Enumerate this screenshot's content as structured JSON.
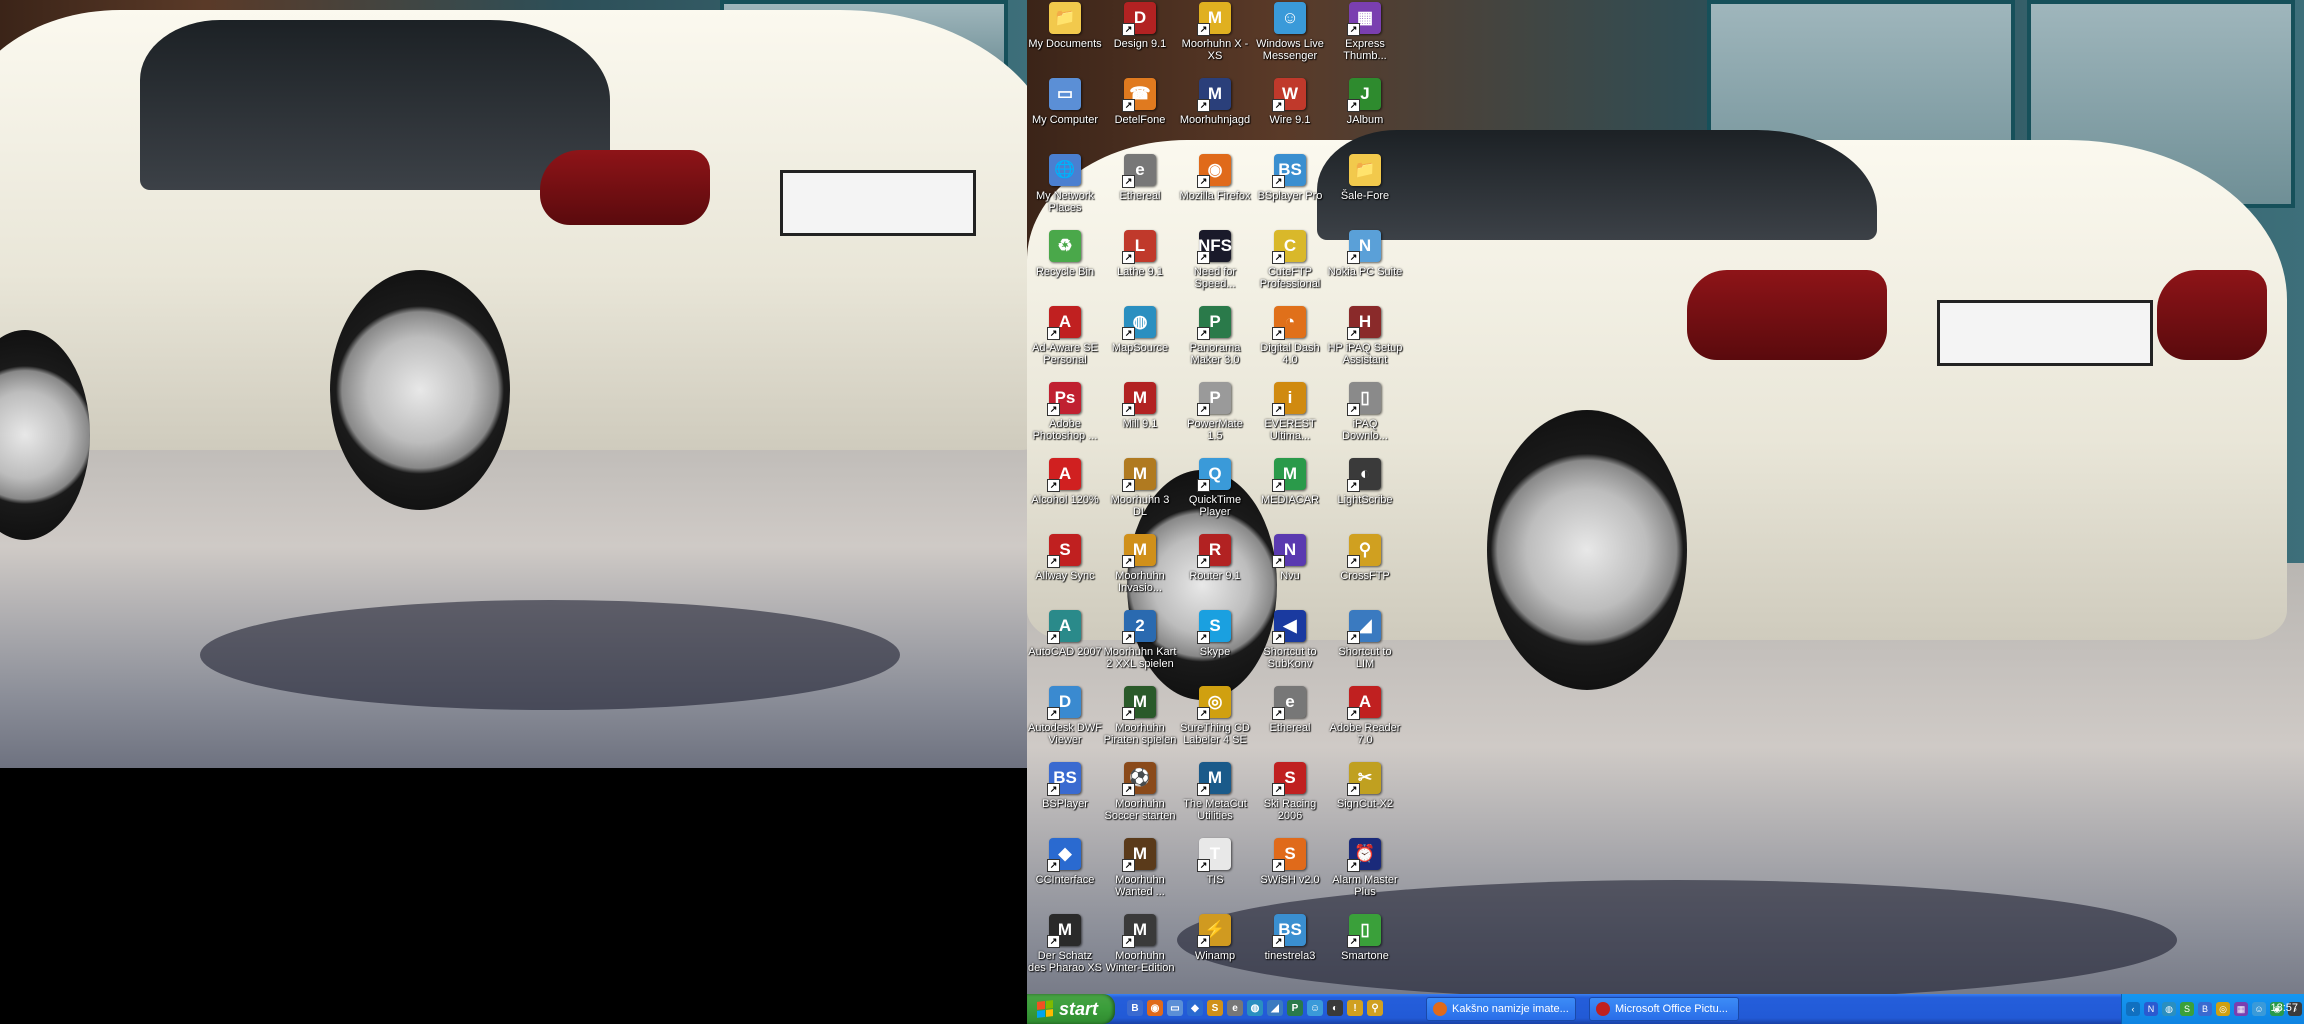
{
  "desktop": {
    "icons": [
      {
        "id": "my-documents",
        "label": "My Documents",
        "color": "#f2c94c",
        "glyph": "📁",
        "shortcut": false
      },
      {
        "id": "design-9-1",
        "label": "Design 9.1",
        "color": "#b22222",
        "glyph": "D",
        "shortcut": true
      },
      {
        "id": "moorhuhn-x-xs",
        "label": "Moorhuhn X -\nXS",
        "color": "#e0b020",
        "glyph": "M",
        "shortcut": true
      },
      {
        "id": "windows-live-messenger",
        "label": "Windows Live\nMessenger",
        "color": "#3a9ad9",
        "glyph": "☺",
        "shortcut": false
      },
      {
        "id": "express-thumb",
        "label": "Express\nThumb...",
        "color": "#7a3fb0",
        "glyph": "▦",
        "shortcut": true
      },
      {
        "id": "my-computer",
        "label": "My Computer",
        "color": "#5b8fd6",
        "glyph": "▭",
        "shortcut": false
      },
      {
        "id": "detelfone",
        "label": "DetelFone",
        "color": "#e07a1f",
        "glyph": "☎",
        "shortcut": true
      },
      {
        "id": "moorhuhnjagd",
        "label": "Moorhuhnjagd",
        "color": "#2a3f7a",
        "glyph": "M",
        "shortcut": true
      },
      {
        "id": "wire-9-1",
        "label": "Wire 9.1",
        "color": "#c0392b",
        "glyph": "W",
        "shortcut": true
      },
      {
        "id": "jalbum",
        "label": "JAlbum",
        "color": "#2e8b2e",
        "glyph": "J",
        "shortcut": true
      },
      {
        "id": "my-network-places",
        "label": "My Network\nPlaces",
        "color": "#4a7fd0",
        "glyph": "🌐",
        "shortcut": false
      },
      {
        "id": "ethereal-1",
        "label": "Ethereal",
        "color": "#777777",
        "glyph": "e",
        "shortcut": true
      },
      {
        "id": "mozilla-firefox",
        "label": "Mozilla Firefox",
        "color": "#e06a1a",
        "glyph": "◉",
        "shortcut": true
      },
      {
        "id": "bsplayer-pro",
        "label": "BSplayer Pro",
        "color": "#3a8fd0",
        "glyph": "BS",
        "shortcut": true
      },
      {
        "id": "sale-fore",
        "label": "Šale-Fore",
        "color": "#f2c94c",
        "glyph": "📁",
        "shortcut": false
      },
      {
        "id": "recycle-bin",
        "label": "Recycle Bin",
        "color": "#4aa84a",
        "glyph": "♻",
        "shortcut": false
      },
      {
        "id": "lathe-9-1",
        "label": "Lathe 9.1",
        "color": "#c0392b",
        "glyph": "L",
        "shortcut": true
      },
      {
        "id": "need-for-speed",
        "label": "Need for\nSpeed...",
        "color": "#1a1a2a",
        "glyph": "NFS",
        "shortcut": true
      },
      {
        "id": "cuteftp-professional",
        "label": "CuteFTP\nProfessional",
        "color": "#d9b82a",
        "glyph": "C",
        "shortcut": true
      },
      {
        "id": "nokia-pc-suite",
        "label": "Nokia PC Suite",
        "color": "#5aa0d8",
        "glyph": "N",
        "shortcut": true
      },
      {
        "id": "ad-aware-se",
        "label": "Ad-Aware SE\nPersonal",
        "color": "#c02020",
        "glyph": "A",
        "shortcut": true
      },
      {
        "id": "mapsource",
        "label": "MapSource",
        "color": "#2a8fc0",
        "glyph": "◍",
        "shortcut": true
      },
      {
        "id": "panorama-maker",
        "label": "Panorama\nMaker 3.0",
        "color": "#2a7a4a",
        "glyph": "P",
        "shortcut": true
      },
      {
        "id": "digital-dash",
        "label": "Digital Dash\n4.0",
        "color": "#e0701a",
        "glyph": "◔",
        "shortcut": true
      },
      {
        "id": "hp-ipaq-setup",
        "label": "HP iPAQ Setup\nAssistant",
        "color": "#8a2a2a",
        "glyph": "H",
        "shortcut": true
      },
      {
        "id": "adobe-photoshop",
        "label": "Adobe\nPhotoshop ...",
        "color": "#c02030",
        "glyph": "Ps",
        "shortcut": true
      },
      {
        "id": "mill-9-1",
        "label": "Mill 9.1",
        "color": "#b22222",
        "glyph": "M",
        "shortcut": true
      },
      {
        "id": "powermate",
        "label": "PowerMate\n1.5",
        "color": "#9a9a9a",
        "glyph": "P",
        "shortcut": true
      },
      {
        "id": "everest-ultimate",
        "label": "EVEREST\nUltima...",
        "color": "#d08a10",
        "glyph": "i",
        "shortcut": true
      },
      {
        "id": "ipaq-downlo",
        "label": "iPAQ\nDownlo...",
        "color": "#8a8a8a",
        "glyph": "▯",
        "shortcut": true
      },
      {
        "id": "alcohol-120",
        "label": "Alcohol 120%",
        "color": "#d02020",
        "glyph": "A",
        "shortcut": true
      },
      {
        "id": "moorhuhn-3-dl",
        "label": "Moorhuhn 3\nDL",
        "color": "#b07a20",
        "glyph": "M",
        "shortcut": true
      },
      {
        "id": "quicktime-player",
        "label": "QuickTime\nPlayer",
        "color": "#3a9ad9",
        "glyph": "Q",
        "shortcut": true
      },
      {
        "id": "mediacar",
        "label": "MEDIACAR",
        "color": "#2a9a4a",
        "glyph": "M",
        "shortcut": true
      },
      {
        "id": "lightscribe",
        "label": "LightScribe",
        "color": "#3a3a3a",
        "glyph": "◐",
        "shortcut": true
      },
      {
        "id": "allway-sync",
        "label": "Allway Sync",
        "color": "#c02020",
        "glyph": "S",
        "shortcut": true
      },
      {
        "id": "moorhuhn-invasion",
        "label": "Moorhuhn\nInvasio...",
        "color": "#d0901a",
        "glyph": "M",
        "shortcut": true
      },
      {
        "id": "router-9-1",
        "label": "Router 9.1",
        "color": "#b22222",
        "glyph": "R",
        "shortcut": true
      },
      {
        "id": "nvu",
        "label": "Nvu",
        "color": "#5a3ab0",
        "glyph": "N",
        "shortcut": true
      },
      {
        "id": "crossftp",
        "label": "CrossFTP",
        "color": "#d0a020",
        "glyph": "⚲",
        "shortcut": true
      },
      {
        "id": "autocad-2007",
        "label": "AutoCAD 2007",
        "color": "#2a8a8a",
        "glyph": "A",
        "shortcut": true
      },
      {
        "id": "moorhuhn-kart-2",
        "label": "Moorhuhn Kart\n2 XXL spielen",
        "color": "#2a6ab0",
        "glyph": "2",
        "shortcut": true
      },
      {
        "id": "skype",
        "label": "Skype",
        "color": "#1aa0e0",
        "glyph": "S",
        "shortcut": true
      },
      {
        "id": "shortcut-subkonv",
        "label": "Shortcut to\nSubKonv",
        "color": "#1a3aa0",
        "glyph": "◀",
        "shortcut": true
      },
      {
        "id": "shortcut-lim",
        "label": "Shortcut to\nLIM",
        "color": "#3a7ac0",
        "glyph": "◢",
        "shortcut": true
      },
      {
        "id": "autodesk-dwf-viewer",
        "label": "Autodesk DWF\nViewer",
        "color": "#3a8ad0",
        "glyph": "D",
        "shortcut": true
      },
      {
        "id": "moorhuhn-piraten",
        "label": "Moorhuhn\nPiraten spielen",
        "color": "#2a5a2a",
        "glyph": "M",
        "shortcut": true
      },
      {
        "id": "surething-cd-labeler",
        "label": "SureThing CD\nLabeler 4 SE",
        "color": "#d0a010",
        "glyph": "◎",
        "shortcut": true
      },
      {
        "id": "ethereal-2",
        "label": "Ethereal",
        "color": "#777777",
        "glyph": "e",
        "shortcut": true
      },
      {
        "id": "adobe-reader",
        "label": "Adobe Reader\n7.0",
        "color": "#c02020",
        "glyph": "A",
        "shortcut": true
      },
      {
        "id": "bsplayer",
        "label": "BSPlayer",
        "color": "#3a6ad0",
        "glyph": "BS",
        "shortcut": true
      },
      {
        "id": "moorhuhn-soccer",
        "label": "Moorhuhn\nSoccer starten",
        "color": "#8a4a1a",
        "glyph": "⚽",
        "shortcut": true
      },
      {
        "id": "metacut-utilities",
        "label": "The MetaCut\nUtilities",
        "color": "#1a5a8a",
        "glyph": "M",
        "shortcut": true
      },
      {
        "id": "ski-racing-2006",
        "label": "Ski Racing\n2006",
        "color": "#c02020",
        "glyph": "S",
        "shortcut": true
      },
      {
        "id": "signcut-x2",
        "label": "SignCut-X2",
        "color": "#c0a020",
        "glyph": "✂",
        "shortcut": true
      },
      {
        "id": "ccinterface",
        "label": "CCInterface",
        "color": "#2a6ad0",
        "glyph": "◆",
        "shortcut": true
      },
      {
        "id": "moorhuhn-wanted",
        "label": "Moorhuhn\nWanted ...",
        "color": "#5a3a1a",
        "glyph": "M",
        "shortcut": true
      },
      {
        "id": "tis",
        "label": "TIS",
        "color": "#e8e8e8",
        "glyph": "T",
        "shortcut": true
      },
      {
        "id": "swish-v2",
        "label": "SWiSH v2.0",
        "color": "#e06a1a",
        "glyph": "S",
        "shortcut": true
      },
      {
        "id": "alarm-master-plus",
        "label": "Alarm Master\nPlus",
        "color": "#1a2a7a",
        "glyph": "⏰",
        "shortcut": true
      },
      {
        "id": "der-schatz",
        "label": "Der Schatz\ndes Pharao XS",
        "color": "#2a2a2a",
        "glyph": "M",
        "shortcut": true
      },
      {
        "id": "moorhuhn-winter",
        "label": "Moorhuhn\nWinter-Edition",
        "color": "#3a3a3a",
        "glyph": "M",
        "shortcut": true
      },
      {
        "id": "winamp",
        "label": "Winamp",
        "color": "#d09a20",
        "glyph": "⚡",
        "shortcut": true
      },
      {
        "id": "tinestrela3",
        "label": "tinestrela3",
        "color": "#3a8fd0",
        "glyph": "BS",
        "shortcut": true
      },
      {
        "id": "smartone",
        "label": "Smartone",
        "color": "#3aa03a",
        "glyph": "▯",
        "shortcut": true
      }
    ]
  },
  "taskbar": {
    "start_label": "start",
    "quick_launch": [
      {
        "id": "ql-bs",
        "glyph": "B",
        "color": "#3a6ad0"
      },
      {
        "id": "ql-firefox",
        "glyph": "◉",
        "color": "#e06a1a"
      },
      {
        "id": "ql-app3",
        "glyph": "▭",
        "color": "#5b8fd6"
      },
      {
        "id": "ql-app4",
        "glyph": "◆",
        "color": "#2a6ad0"
      },
      {
        "id": "ql-app5",
        "glyph": "S",
        "color": "#d0901a"
      },
      {
        "id": "ql-app6",
        "glyph": "e",
        "color": "#777777"
      },
      {
        "id": "ql-app7",
        "glyph": "◍",
        "color": "#2a8fc0"
      },
      {
        "id": "ql-app8",
        "glyph": "◢",
        "color": "#3a7ac0"
      },
      {
        "id": "ql-app9",
        "glyph": "P",
        "color": "#2a7a4a"
      },
      {
        "id": "ql-app10",
        "glyph": "☺",
        "color": "#3a9ad9"
      },
      {
        "id": "ql-app11",
        "glyph": "◐",
        "color": "#3a3a3a"
      },
      {
        "id": "ql-app12",
        "glyph": "!",
        "color": "#d0a020"
      },
      {
        "id": "ql-app13",
        "glyph": "⚲",
        "color": "#d0a020"
      }
    ],
    "tasks": [
      {
        "id": "task-firefox",
        "label": "Kakšno namizje imate...",
        "color": "#e06a1a"
      },
      {
        "id": "task-office-picture",
        "label": "Microsoft Office Pictu...",
        "color": "#c02020"
      }
    ],
    "tray_icons": [
      {
        "id": "tray-1",
        "glyph": "‹",
        "color": "#1070c0"
      },
      {
        "id": "tray-2",
        "glyph": "N",
        "color": "#2a5ad0"
      },
      {
        "id": "tray-3",
        "glyph": "◍",
        "color": "#2a8fc0"
      },
      {
        "id": "tray-4",
        "glyph": "S",
        "color": "#3aa03a"
      },
      {
        "id": "tray-5",
        "glyph": "B",
        "color": "#3a6ad0"
      },
      {
        "id": "tray-6",
        "glyph": "◎",
        "color": "#d0a010"
      },
      {
        "id": "tray-7",
        "glyph": "▦",
        "color": "#7a3fb0"
      },
      {
        "id": "tray-8",
        "glyph": "☺",
        "color": "#3a9ad9"
      },
      {
        "id": "tray-9",
        "glyph": "◉",
        "color": "#2a9a4a"
      },
      {
        "id": "tray-10",
        "glyph": "♪",
        "color": "#3a3a3a"
      }
    ],
    "clock": "18:57"
  }
}
